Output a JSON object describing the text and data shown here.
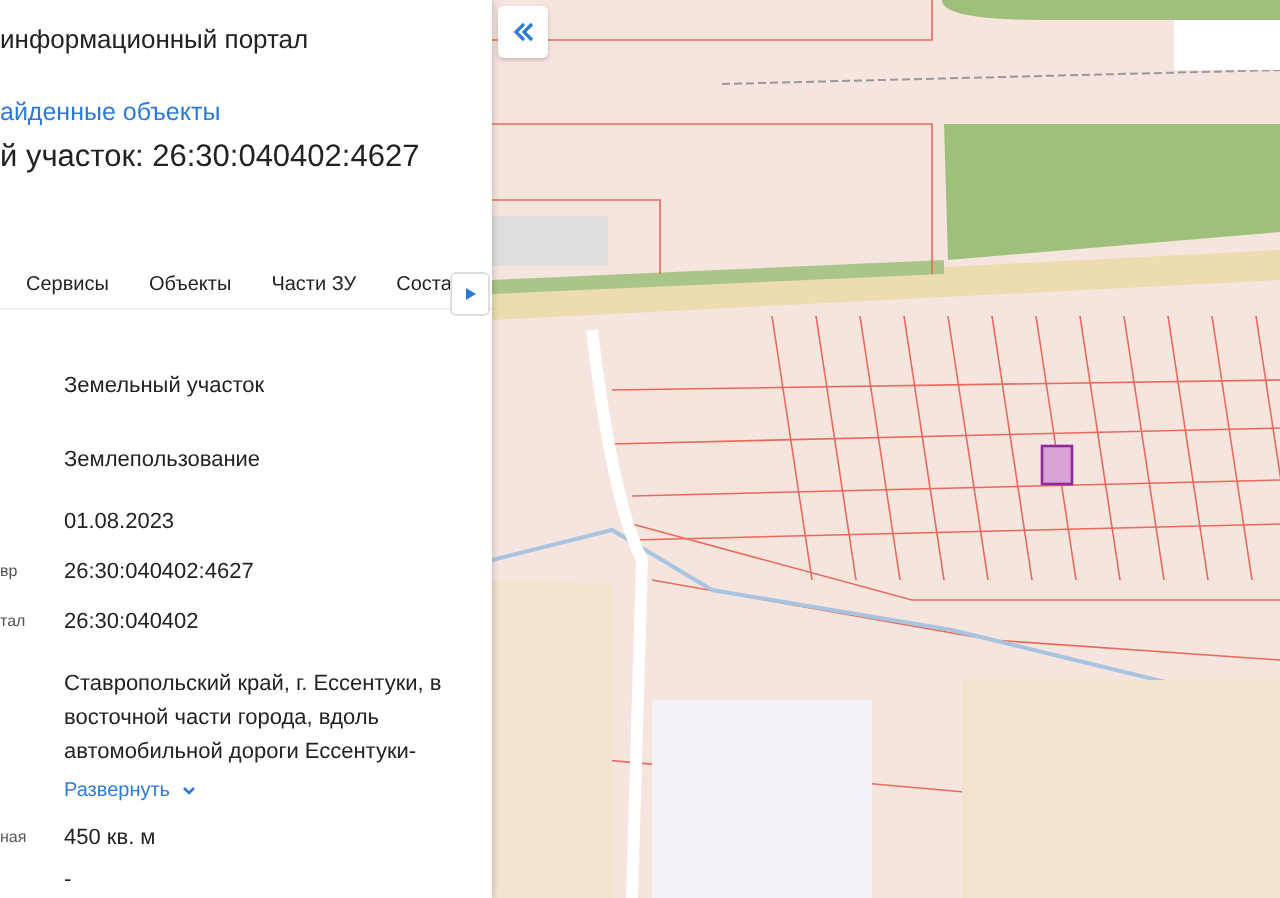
{
  "header": {
    "title": "информационный портал"
  },
  "back_link": "айденные объекты",
  "heading": "й участок: 26:30:040402:4627",
  "tabs": [
    "Сервисы",
    "Объекты",
    "Части ЗУ",
    "Соста"
  ],
  "fields": [
    {
      "value": "Земельный участок"
    },
    {
      "value": "Землепользование"
    },
    {
      "value": "01.08.2023"
    },
    {
      "label": "вр",
      "value": "26:30:040402:4627"
    },
    {
      "label": "тал",
      "value": "26:30:040402"
    },
    {
      "value": "Ставропольский край, г. Ессентуки, в восточной части города, вдоль автомобильной дороги Ессентуки-",
      "expand": "Развернуть"
    },
    {
      "label": "ная",
      "value": "450 кв. м"
    },
    {
      "value": "-"
    }
  ]
}
